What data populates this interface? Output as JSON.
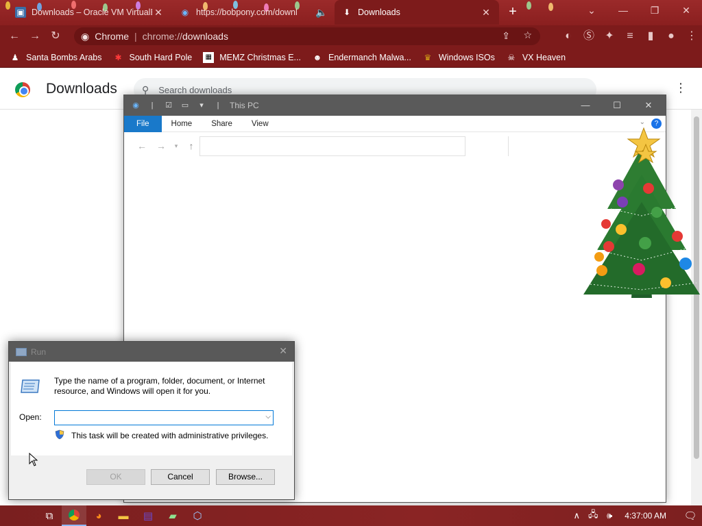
{
  "colors": {
    "tab_bg": "#8a1f1f",
    "active_tab": "#7d1b1b",
    "file_tab": "#1979ca",
    "focus_border": "#0078d7"
  },
  "browser": {
    "tabs": [
      {
        "title": "Downloads – Oracle VM VirtualB",
        "icon": "virtualbox-icon"
      },
      {
        "title": "https://bobpony.com/downl",
        "icon": "globe-icon",
        "audio": "speaker-icon"
      },
      {
        "title": "Downloads",
        "icon": "download-icon"
      }
    ],
    "omnibox": {
      "site": "Chrome",
      "url_prefix": "chrome://",
      "url_path": "downloads"
    },
    "bookmarks": [
      {
        "label": "Santa Bombs Arabs",
        "icon": "bomb-icon"
      },
      {
        "label": "South Hard Pole",
        "icon": "virus-icon"
      },
      {
        "label": "MEMZ Christmas E...",
        "icon": "memz-icon"
      },
      {
        "label": "Endermanch Malwa...",
        "icon": "enderman-icon"
      },
      {
        "label": "Windows ISOs",
        "icon": "trophy-icon"
      },
      {
        "label": "VX Heaven",
        "icon": "vx-icon"
      }
    ]
  },
  "downloads_page": {
    "title": "Downloads",
    "search_placeholder": "Search downloads"
  },
  "explorer": {
    "title": "This PC",
    "ribbon_tabs": [
      "File",
      "Home",
      "Share",
      "View"
    ],
    "help": "?"
  },
  "run_dialog": {
    "title": "Run",
    "description": "Type the name of a program, folder, document, or Internet resource, and Windows will open it for you.",
    "open_label": "Open:",
    "open_value": "",
    "admin_note": "This task will be created with administrative privileges.",
    "buttons": {
      "ok": "OK",
      "cancel": "Cancel",
      "browse": "Browse..."
    }
  },
  "taskbar": {
    "apps": [
      "task-view-icon",
      "chrome-icon",
      "firefox-icon",
      "file-explorer-icon",
      "winrar-icon",
      "notepadpp-icon",
      "virtualbox-icon"
    ],
    "clock": "4:37:00 AM"
  }
}
